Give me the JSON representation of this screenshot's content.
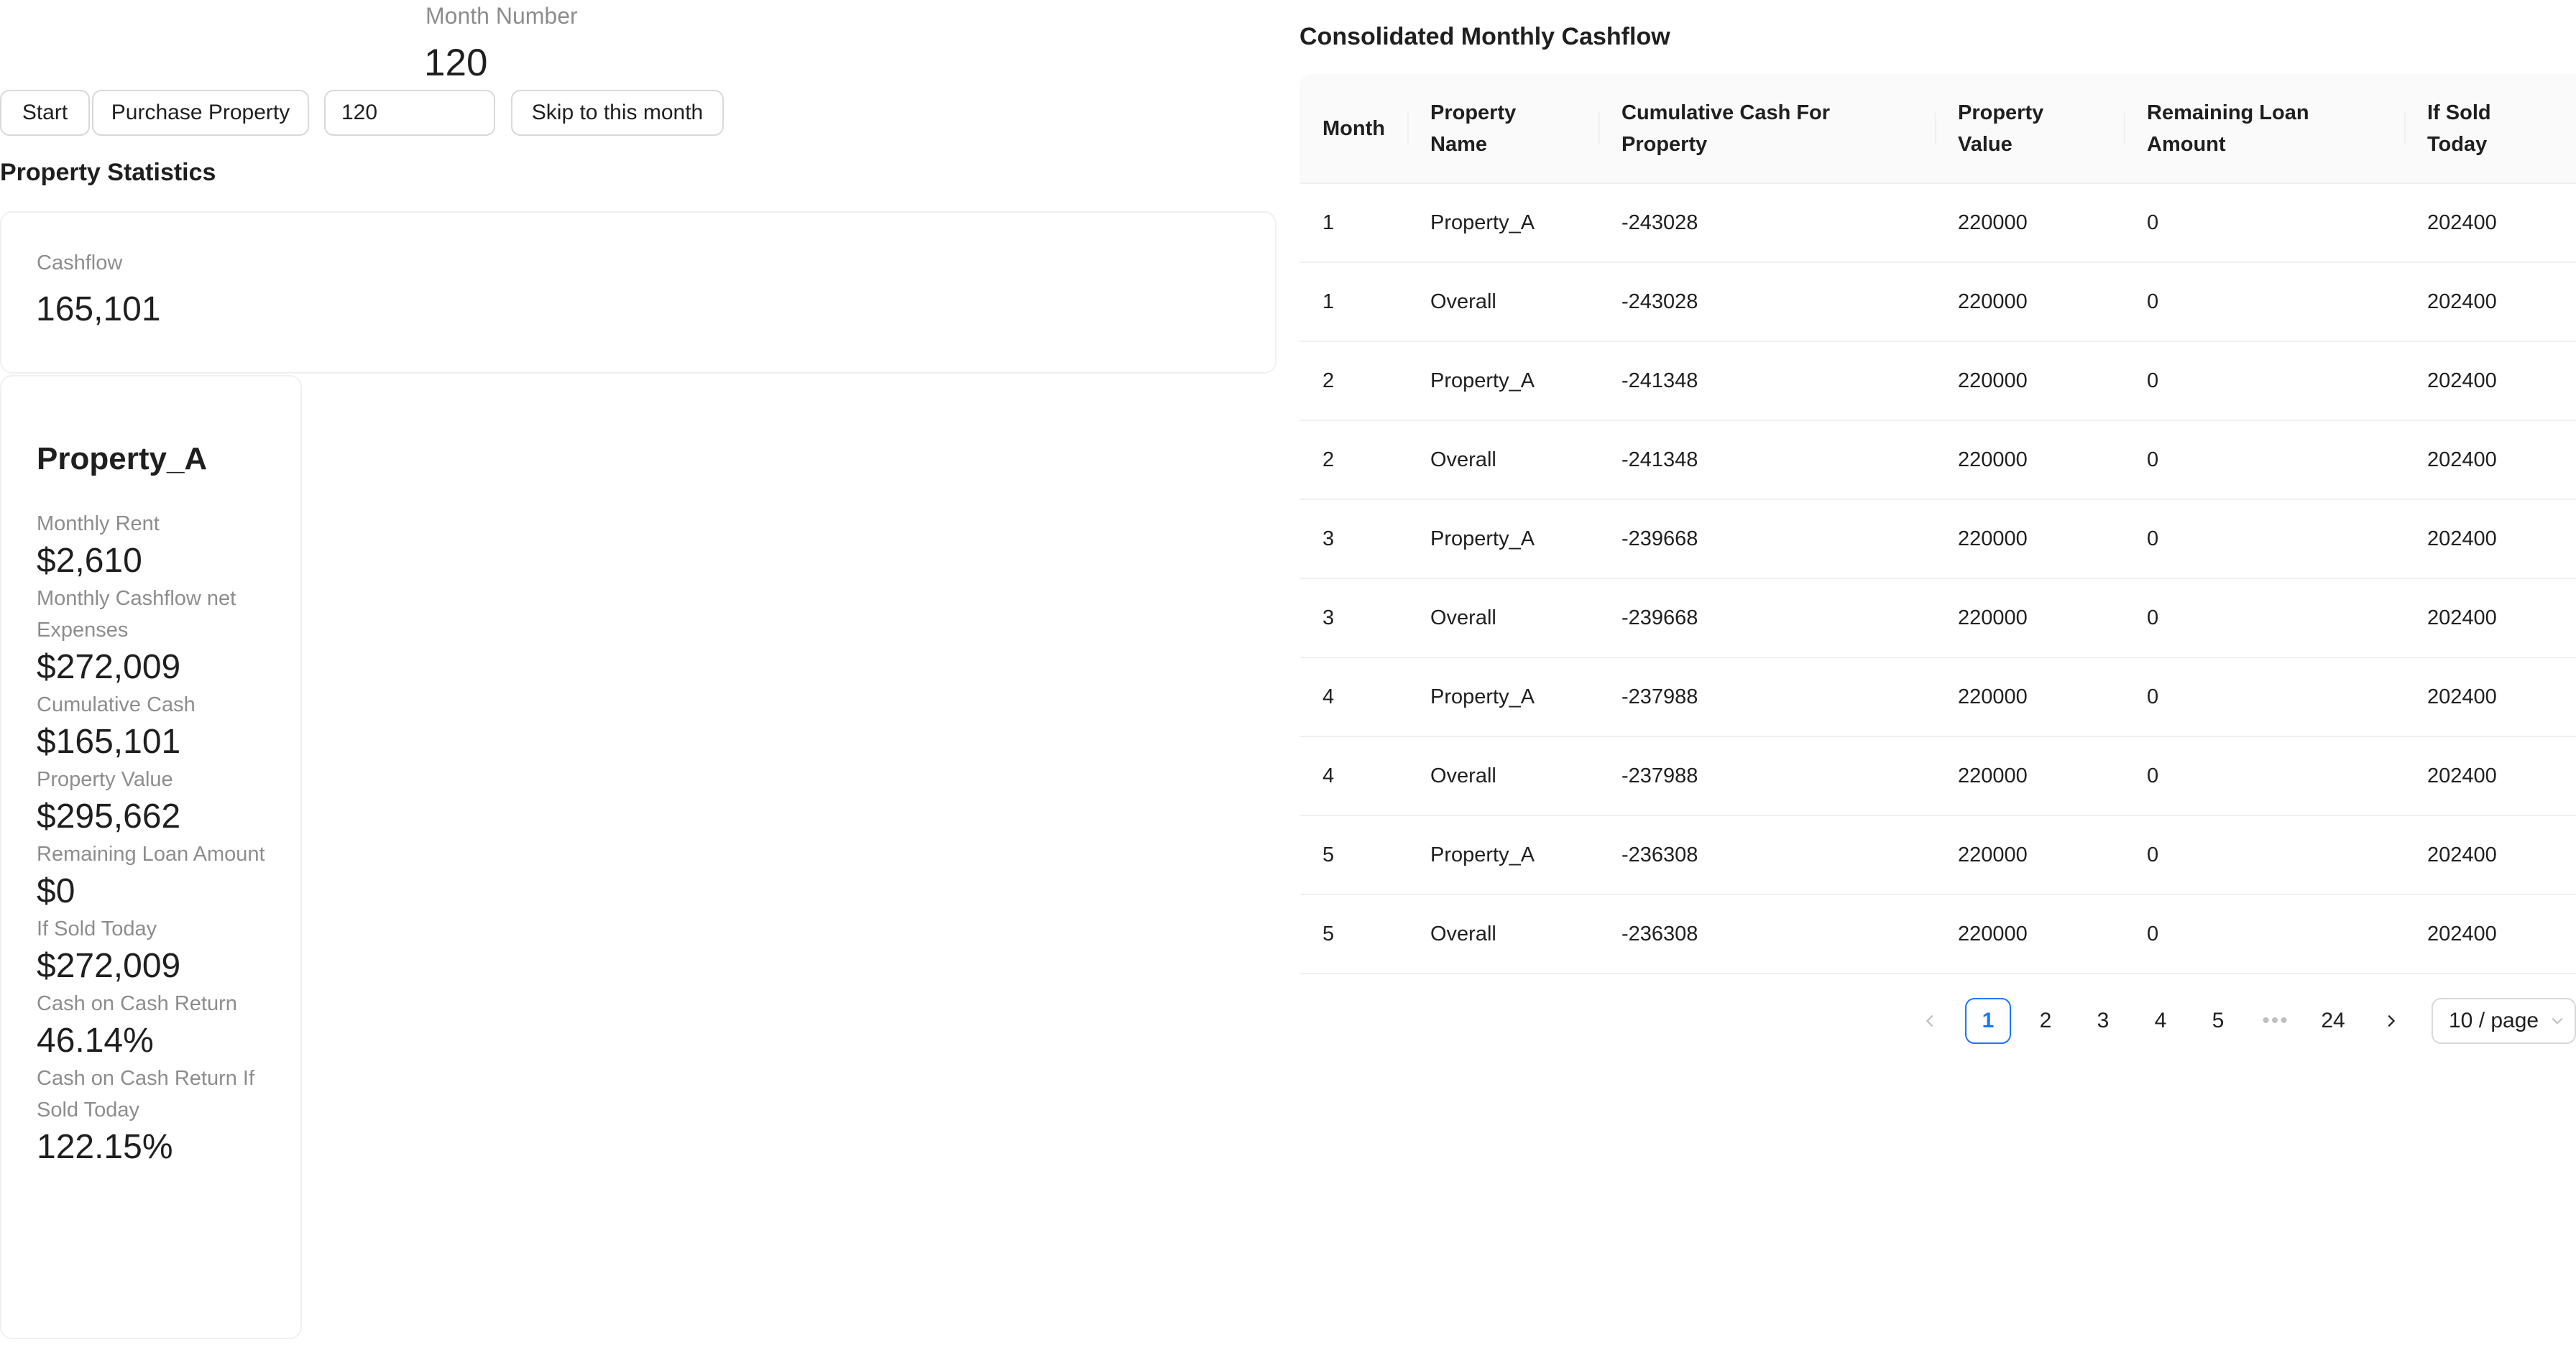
{
  "month_stat": {
    "label": "Month Number",
    "value": "120"
  },
  "controls": {
    "start_label": "Start",
    "purchase_label": "Purchase Property",
    "month_input_value": "120",
    "skip_label": "Skip to this month"
  },
  "property_statistics": {
    "heading": "Property Statistics",
    "cashflow": {
      "label": "Cashflow",
      "value": "165,101"
    }
  },
  "property_card": {
    "name": "Property_A",
    "stats": [
      {
        "label": "Monthly Rent",
        "value": "$2,610"
      },
      {
        "label": "Monthly Cashflow net Expenses",
        "value": "$272,009"
      },
      {
        "label": "Cumulative Cash",
        "value": "$165,101"
      },
      {
        "label": "Property Value",
        "value": "$295,662"
      },
      {
        "label": "Remaining Loan Amount",
        "value": "$0"
      },
      {
        "label": "If Sold Today",
        "value": "$272,009"
      },
      {
        "label": "Cash on Cash Return",
        "value": "46.14%"
      },
      {
        "label": "Cash on Cash Return If Sold Today",
        "value": "122.15%"
      }
    ]
  },
  "cashflow_table": {
    "heading": "Consolidated Monthly Cashflow",
    "columns": [
      "Month",
      "Property Name",
      "Cumulative Cash For Property",
      "Property Value",
      "Remaining Loan Amount",
      "If Sold Today"
    ],
    "rows": [
      [
        "1",
        "Property_A",
        "-243028",
        "220000",
        "0",
        "202400"
      ],
      [
        "1",
        "Overall",
        "-243028",
        "220000",
        "0",
        "202400"
      ],
      [
        "2",
        "Property_A",
        "-241348",
        "220000",
        "0",
        "202400"
      ],
      [
        "2",
        "Overall",
        "-241348",
        "220000",
        "0",
        "202400"
      ],
      [
        "3",
        "Property_A",
        "-239668",
        "220000",
        "0",
        "202400"
      ],
      [
        "3",
        "Overall",
        "-239668",
        "220000",
        "0",
        "202400"
      ],
      [
        "4",
        "Property_A",
        "-237988",
        "220000",
        "0",
        "202400"
      ],
      [
        "4",
        "Overall",
        "-237988",
        "220000",
        "0",
        "202400"
      ],
      [
        "5",
        "Property_A",
        "-236308",
        "220000",
        "0",
        "202400"
      ],
      [
        "5",
        "Overall",
        "-236308",
        "220000",
        "0",
        "202400"
      ]
    ]
  },
  "pagination": {
    "prev_icon": "chevron-left-icon",
    "pages": [
      "1",
      "2",
      "3",
      "4",
      "5"
    ],
    "current_page": "1",
    "ellipsis": "•••",
    "last_page": "24",
    "next_icon": "chevron-right-icon",
    "page_size": "10 / page"
  },
  "colors": {
    "accent": "#1677ff",
    "border": "#d9d9d9",
    "header_bg": "#fafafa"
  }
}
